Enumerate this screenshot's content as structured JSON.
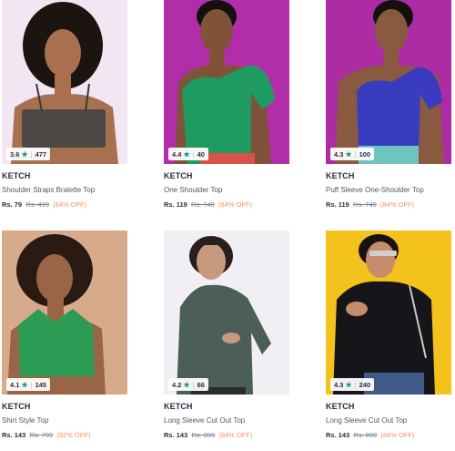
{
  "products": [
    {
      "rating": "3.6",
      "count": "477",
      "brand": "KETCH",
      "title": "Shoulder Straps Bralette Top",
      "price": "Rs. 79",
      "mrp": "Rs. 499",
      "discount": "(84% OFF)",
      "colors": {
        "bg": "#f1e6f1",
        "top": "#4b4846",
        "skin": "#a8704f",
        "hair": "#1c1411"
      }
    },
    {
      "rating": "4.4",
      "count": "40",
      "brand": "KETCH",
      "title": "One Shoulder Top",
      "price": "Rs. 119",
      "mrp": "Rs. 749",
      "discount": "(84% OFF)",
      "colors": {
        "bg": "#b22da8",
        "top": "#1f9a61",
        "skin": "#80523a",
        "hair": "#141010"
      }
    },
    {
      "rating": "4.3",
      "count": "100",
      "brand": "KETCH",
      "title": "Puff Sleeve One-Shoulder Top",
      "price": "Rs. 119",
      "mrp": "Rs. 749",
      "discount": "(84% OFF)",
      "colors": {
        "bg": "#ad2ba3",
        "top": "#3a3cc0",
        "skin": "#8a5a40",
        "hair": "#141010"
      }
    },
    {
      "rating": "4.1",
      "count": "145",
      "brand": "KETCH",
      "title": "Shirt Style Top",
      "price": "Rs. 143",
      "mrp": "Rs. 799",
      "discount": "(82% OFF)",
      "colors": {
        "bg": "#d6aa8b",
        "top": "#2c9c55",
        "skin": "#9a6446",
        "hair": "#2a1a14"
      }
    },
    {
      "rating": "4.2",
      "count": "66",
      "brand": "KETCH",
      "title": "Long Sleeve Cut Out Top",
      "price": "Rs. 143",
      "mrp": "Rs. 899",
      "discount": "(84% OFF)",
      "colors": {
        "bg": "#f1eef4",
        "top": "#4b5e57",
        "skin": "#c79a80",
        "hair": "#2a1e1a"
      }
    },
    {
      "rating": "4.3",
      "count": "240",
      "brand": "KETCH",
      "title": "Long Sleeve Cut Out Top",
      "price": "Rs. 143",
      "mrp": "Rs. 899",
      "discount": "(84% OFF)",
      "colors": {
        "bg": "#f3c21c",
        "top": "#16161a",
        "skin": "#c58d6c",
        "hair": "#1a1210"
      }
    }
  ]
}
